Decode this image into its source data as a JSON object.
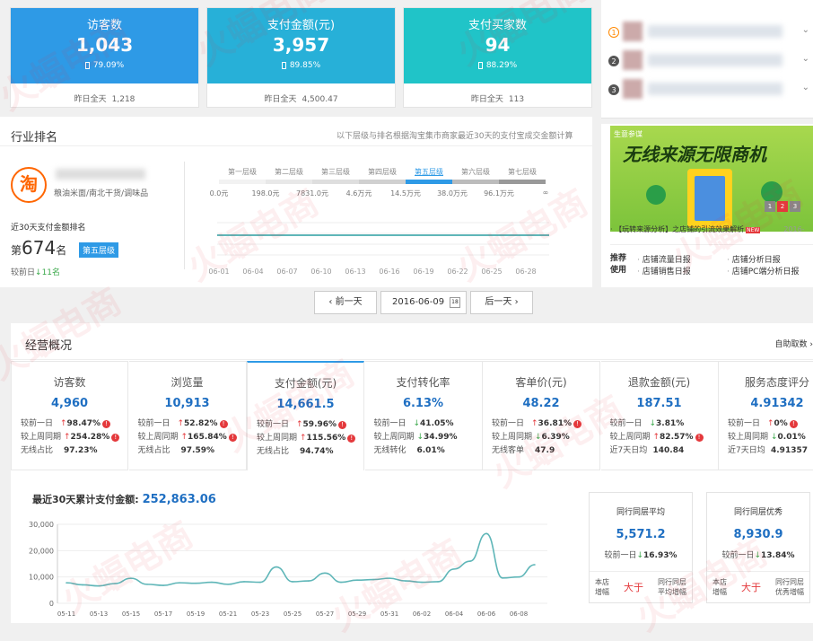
{
  "kpis": [
    {
      "title": "访客数",
      "value": "1,043",
      "change": "79.09%",
      "yesterday_label": "昨日全天",
      "yesterday": "1,218",
      "color": "#2e9ae6"
    },
    {
      "title": "支付金额(元)",
      "value": "3,957",
      "change": "89.85%",
      "yesterday_label": "昨日全天",
      "yesterday": "4,500.47",
      "color": "#27b0d8"
    },
    {
      "title": "支付买家数",
      "value": "94",
      "change": "88.29%",
      "yesterday_label": "昨日全天",
      "yesterday": "113",
      "color": "#20c4c8"
    }
  ],
  "ranklist": {
    "nums": [
      "1",
      "2",
      "3"
    ]
  },
  "industry": {
    "title": "行业排名",
    "note": "以下层级与排名根据淘宝集市商家最近30天的支付宝成交金额计算",
    "shop_icon": "淘",
    "category": "粮油米面/南北干货/调味品",
    "rank_label": "近30天支付金额排名",
    "rank_prefix": "第",
    "rank": "674",
    "rank_suffix": "名",
    "level_badge": "第五层级",
    "compare_label": "较前日",
    "compare_value": "11名",
    "levels": [
      "第一层级",
      "第二层级",
      "第三层级",
      "第四层级",
      "第五层级",
      "第六层级",
      "第七层级"
    ],
    "thresholds": [
      "0.0元",
      "198.0元",
      "7831.0元",
      "4.6万元",
      "14.5万元",
      "38.0万元",
      "96.1万元",
      "∞"
    ],
    "dates": [
      "06-01",
      "06-04",
      "06-07",
      "06-10",
      "06-13",
      "06-16",
      "06-19",
      "06-22",
      "06-25",
      "06-28"
    ]
  },
  "promo": {
    "tag": "生意参谋",
    "banner_text": "无线来源无限商机",
    "news": "【玩转来源分析】之店铺的引流效果解析",
    "news_date": "2016-",
    "rec_label1": "推荐",
    "rec_label2": "使用",
    "links": [
      "店铺流量日报",
      "店铺分析日报",
      "店铺销售日报",
      "店铺PC端分析日报"
    ],
    "pages": [
      "1",
      "2",
      "3"
    ]
  },
  "date_nav": {
    "prev": "前一天",
    "date": "2016-06-09",
    "next": "后一天"
  },
  "overview": {
    "title": "经营概况",
    "auto_refresh": "自助取数",
    "metrics": [
      {
        "title": "访客数",
        "value": "4,960",
        "r1l": "较前一日",
        "r1": "98.47%",
        "r1d": "up",
        "r2l": "较上周同期",
        "r2": "254.28%",
        "r2d": "up",
        "r3l": "无线占比",
        "r3": "97.23%"
      },
      {
        "title": "浏览量",
        "value": "10,913",
        "r1l": "较前一日",
        "r1": "52.82%",
        "r1d": "up",
        "r2l": "较上周同期",
        "r2": "165.84%",
        "r2d": "up",
        "r3l": "无线占比",
        "r3": "97.59%"
      },
      {
        "title": "支付金额(元)",
        "value": "14,661.5",
        "r1l": "较前一日",
        "r1": "59.96%",
        "r1d": "up",
        "r2l": "较上周同期",
        "r2": "115.56%",
        "r2d": "up",
        "r3l": "无线占比",
        "r3": "94.74%"
      },
      {
        "title": "支付转化率",
        "value": "6.13%",
        "r1l": "较前一日",
        "r1": "41.05%",
        "r1d": "down",
        "r2l": "较上周同期",
        "r2": "34.99%",
        "r2d": "down",
        "r3l": "无线转化",
        "r3": "6.01%"
      },
      {
        "title": "客单价(元)",
        "value": "48.22",
        "r1l": "较前一日",
        "r1": "36.81%",
        "r1d": "up",
        "r2l": "较上周同期",
        "r2": "6.39%",
        "r2d": "down",
        "r3l": "无线客单",
        "r3": "47.9"
      },
      {
        "title": "退款金额(元)",
        "value": "187.51",
        "r1l": "较前一日",
        "r1": "3.81%",
        "r1d": "down",
        "r2l": "较上周同期",
        "r2": "82.57%",
        "r2d": "up",
        "r3l": "近7天日均",
        "r3": "140.84"
      },
      {
        "title": "服务态度评分",
        "value": "4.91342",
        "r1l": "较前一日",
        "r1": "0%",
        "r1d": "up",
        "r2l": "较上周同期",
        "r2": "0.01%",
        "r2d": "down",
        "r3l": "近7天日均",
        "r3": "4.91357"
      }
    ]
  },
  "chart_data": {
    "type": "line",
    "title": "最近30天累计支付金额:",
    "total": "252,863.06",
    "x": [
      "05-11",
      "05-12",
      "05-13",
      "05-14",
      "05-15",
      "05-16",
      "05-17",
      "05-18",
      "05-19",
      "05-20",
      "05-21",
      "05-22",
      "05-23",
      "05-24",
      "05-25",
      "05-26",
      "05-27",
      "05-28",
      "05-29",
      "05-30",
      "05-31",
      "06-01",
      "06-02",
      "06-03",
      "06-04",
      "06-05",
      "06-06",
      "06-07",
      "06-08",
      "06-09"
    ],
    "xticks": [
      "05-11",
      "05-13",
      "05-15",
      "05-17",
      "05-19",
      "05-21",
      "05-23",
      "05-25",
      "05-27",
      "05-29",
      "05-31",
      "06-02",
      "06-04",
      "06-06",
      "06-08"
    ],
    "yticks": [
      "30,000",
      "20,000",
      "10,000",
      "0"
    ],
    "ylim": [
      0,
      30000
    ],
    "values": [
      7800,
      7000,
      6600,
      7500,
      9500,
      7200,
      6800,
      7800,
      7600,
      8000,
      7200,
      8200,
      8000,
      13800,
      8200,
      8500,
      11500,
      8000,
      8800,
      9000,
      9500,
      8500,
      8000,
      8200,
      13000,
      16000,
      26500,
      9600,
      10000,
      14661
    ],
    "color": "#5fb6b8"
  },
  "compare": [
    {
      "title": "同行同层平均",
      "value": "5,571.2",
      "label": "较前一日",
      "change": "16.93%",
      "dir": "down",
      "left": "本店\n增幅",
      "mid": "大于",
      "right": "同行同层\n平均增幅"
    },
    {
      "title": "同行同层优秀",
      "value": "8,930.9",
      "label": "较前一日",
      "change": "13.84%",
      "dir": "down",
      "left": "本店\n增幅",
      "mid": "大于",
      "right": "同行同层\n优秀增幅"
    }
  ]
}
